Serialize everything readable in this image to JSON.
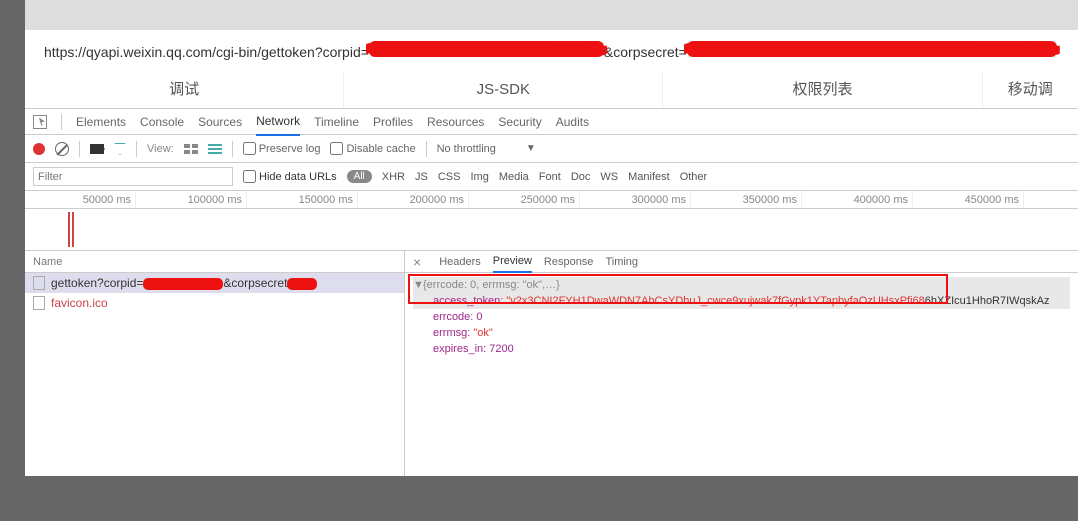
{
  "url": {
    "prefix": "https://qyapi.weixin.qq.com/cgi-bin/gettoken?corpid=",
    "mid": "&corpsecret="
  },
  "topTabs": [
    "调试",
    "JS-SDK",
    "权限列表",
    "移动调"
  ],
  "devTabs": [
    "Elements",
    "Console",
    "Sources",
    "Network",
    "Timeline",
    "Profiles",
    "Resources",
    "Security",
    "Audits"
  ],
  "activeDevTab": "Network",
  "toolbar": {
    "viewLabel": "View:",
    "preserveLog": "Preserve log",
    "disableCache": "Disable cache",
    "throttling": "No throttling"
  },
  "filter": {
    "placeholder": "Filter",
    "hideDataUrls": "Hide data URLs",
    "types": [
      "All",
      "XHR",
      "JS",
      "CSS",
      "Img",
      "Media",
      "Font",
      "Doc",
      "WS",
      "Manifest",
      "Other"
    ]
  },
  "timeline": {
    "ticks": [
      "50000 ms",
      "100000 ms",
      "150000 ms",
      "200000 ms",
      "250000 ms",
      "300000 ms",
      "350000 ms",
      "400000 ms",
      "450000 ms"
    ]
  },
  "requests": {
    "header": "Name",
    "row1_prefix": "gettoken?corpid=",
    "row1_mid": "&corpsecret",
    "row2": "favicon.ico"
  },
  "responseTabs": [
    "Headers",
    "Preview",
    "Response",
    "Timing"
  ],
  "activeResponseTab": "Preview",
  "preview": {
    "summary_pre": "{errcode: 0, errmsg: \"ok\",…}",
    "token_key": "access_token:",
    "token_val": "\"v2x3CNI2FYH1DwaWDN7AhCsYDhuJ_cwce9xujwak7fGypk1YTapbyfaOzUHsxPfi68",
    "token_tail": "6hXZIcu1HhoR7IWqskAz",
    "errcode_key": "errcode:",
    "errcode_val": "0",
    "errmsg_key": "errmsg:",
    "errmsg_val": "\"ok\"",
    "expires_key": "expires_in:",
    "expires_val": "7200"
  }
}
